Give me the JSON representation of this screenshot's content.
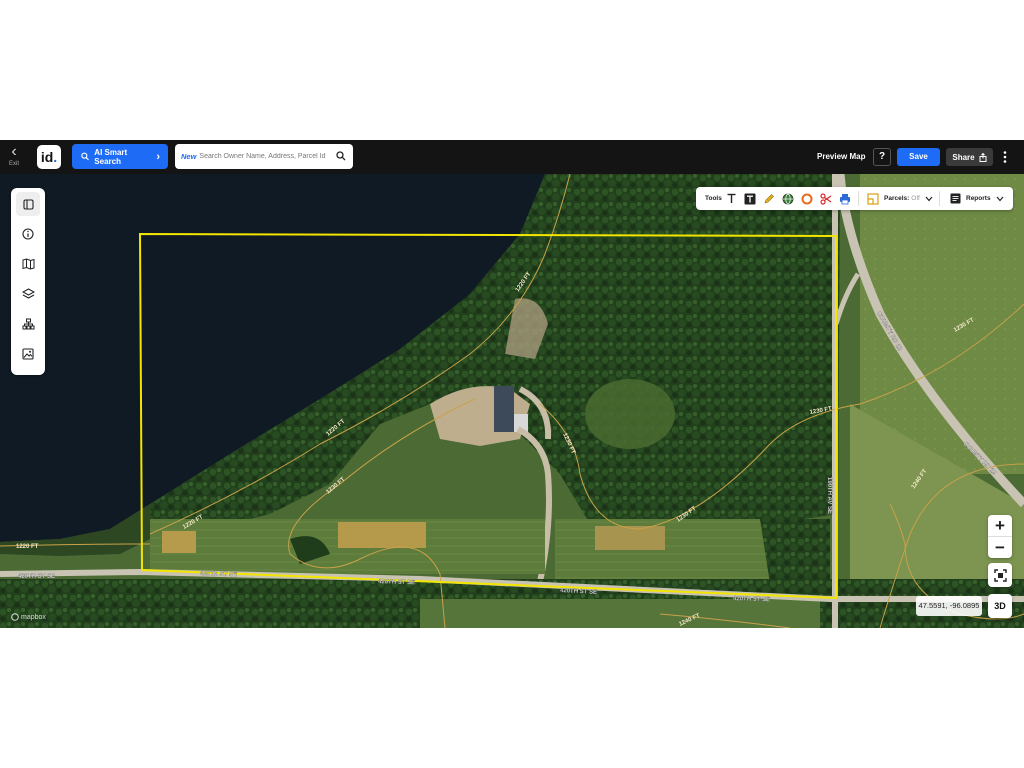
{
  "topbar": {
    "exit_label": "Exit",
    "logo_text": "id",
    "logo_dot": ".",
    "ai_search_label": "AI Smart Search",
    "search_badge": "New",
    "search_placeholder": "Search Owner Name, Address, Parcel Id",
    "preview_label": "Preview Map",
    "help_label": "?",
    "save_label": "Save",
    "share_label": "Share"
  },
  "left_tools": [
    {
      "icon": "panel-icon"
    },
    {
      "icon": "info-icon"
    },
    {
      "icon": "map-icon"
    },
    {
      "icon": "layers-icon"
    },
    {
      "icon": "hierarchy-icon"
    },
    {
      "icon": "image-icon"
    }
  ],
  "toolsbar": {
    "tools_label": "Tools",
    "parcels_label": "Parcels:",
    "parcels_state": "Off",
    "reports_label": "Reports"
  },
  "map_labels": {
    "contour_1220": "1220 FT",
    "contour_1230": "1230 FT",
    "contour_1240": "1240 FT",
    "contour_1220_left": "1220 FT",
    "contour_1240_bottom": "1240 FT",
    "road_420th": "420TH ST SE",
    "road_190th": "190TH AV SE",
    "road_county": "COUNTY RD 12",
    "road_county_2": "COUNTY RD 12",
    "road_west": "420TH ST SE"
  },
  "map_controls": {
    "zoom_in": "+",
    "zoom_out": "−",
    "coords": "47.5591, -96.0895",
    "btn_3d": "3D",
    "attribution": "mapbox"
  },
  "colors": {
    "accent": "#1e6cf5",
    "parcel_outline": "#f2e600",
    "water": "#0f1a24",
    "forest": "#1f3d1a"
  }
}
